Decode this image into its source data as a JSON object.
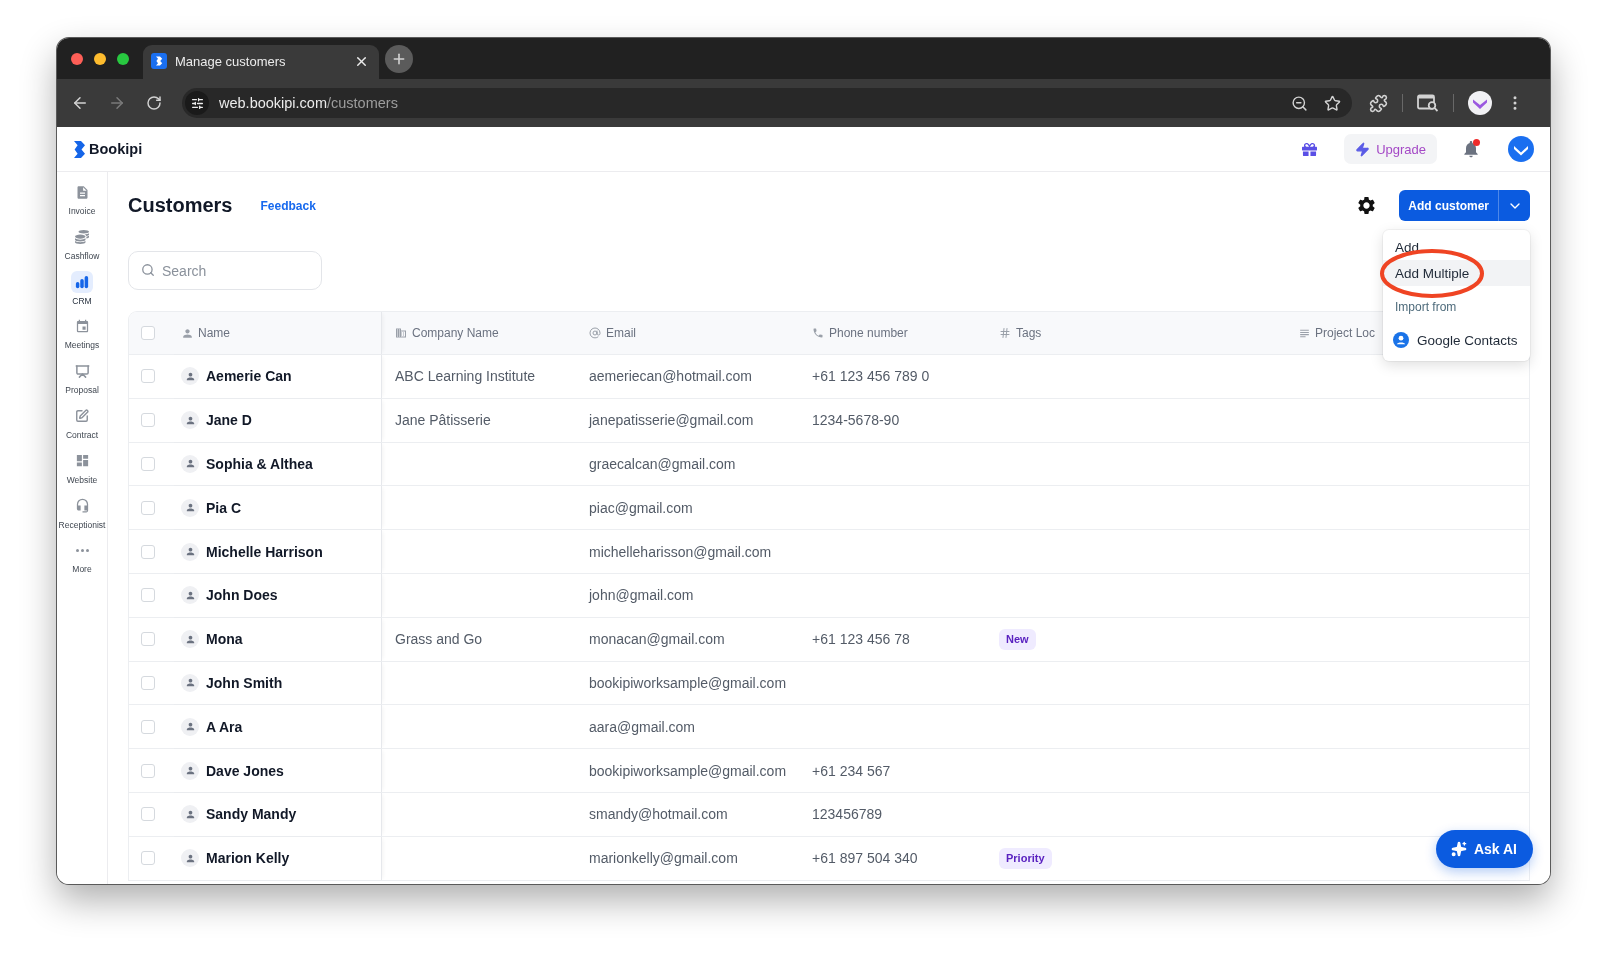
{
  "browser": {
    "tab": {
      "title": "Manage customers"
    },
    "navigation": {
      "forward_disabled": true
    },
    "address": {
      "host": "web.bookipi.com",
      "path": "/customers"
    }
  },
  "app_header": {
    "logo": "Bookipi",
    "upgrade_button": "Upgrade",
    "notifications": {
      "unread": true
    }
  },
  "sidebar": {
    "items": [
      {
        "label": "Invoice",
        "selected": false
      },
      {
        "label": "Cashflow",
        "selected": false
      },
      {
        "label": "CRM",
        "selected": true
      },
      {
        "label": "Meetings",
        "selected": false
      },
      {
        "label": "Proposal",
        "selected": false
      },
      {
        "label": "Contract",
        "selected": false
      },
      {
        "label": "Website",
        "selected": false
      },
      {
        "label": "Receptionist",
        "selected": false
      },
      {
        "label": "More",
        "selected": false
      }
    ]
  },
  "page": {
    "title": "Customers",
    "feedback_link": "Feedback",
    "add_button": "Add customer",
    "search": {
      "placeholder": "Search"
    }
  },
  "add_menu": {
    "items": [
      {
        "kind": "action",
        "label": "Add",
        "selected": false,
        "annotated": false
      },
      {
        "kind": "action",
        "label": "Add Multiple",
        "selected": true,
        "annotated": true
      },
      {
        "kind": "heading",
        "label": "Import from"
      },
      {
        "kind": "source",
        "label": "Google Contacts",
        "selected": false,
        "annotated": false
      }
    ]
  },
  "table": {
    "select_all": {
      "checked": false
    },
    "columns": [
      {
        "kind": "name",
        "label": "Name"
      },
      {
        "kind": "company",
        "label": "Company Name"
      },
      {
        "kind": "email",
        "label": "Email"
      },
      {
        "kind": "phone",
        "label": "Phone number"
      },
      {
        "kind": "tags",
        "label": "Tags"
      },
      {
        "kind": "other",
        "label": "Project Loc"
      }
    ],
    "rows": [
      {
        "checked": false,
        "name": "Aemerie Can",
        "company": "ABC Learning Institute",
        "email": "aemeriecan@hotmail.com",
        "phone": "+61 123 456 789 0"
      },
      {
        "checked": false,
        "name": "Jane D",
        "company": "Jane Pâtisserie",
        "email": "janepatisserie@gmail.com",
        "phone": "1234-5678-90"
      },
      {
        "checked": false,
        "name": "Sophia & Althea",
        "email": "graecalcan@gmail.com"
      },
      {
        "checked": false,
        "name": "Pia C",
        "email": "piac@gmail.com"
      },
      {
        "checked": false,
        "name": "Michelle Harrison",
        "email": "michelleharisson@gmail.com"
      },
      {
        "checked": false,
        "name": "John Does",
        "email": "john@gmail.com"
      },
      {
        "checked": false,
        "name": "Mona",
        "company": "Grass and Go",
        "email": "monacan@gmail.com",
        "phone": "+61 123 456 78",
        "tags": [
          "New"
        ]
      },
      {
        "checked": false,
        "name": "John Smith",
        "email": "bookipiworksample@gmail.com"
      },
      {
        "checked": false,
        "name": "A Ara",
        "email": "aara@gmail.com"
      },
      {
        "checked": false,
        "name": "Dave Jones",
        "email": "bookipiworksample@gmail.com",
        "phone": "+61 234 567"
      },
      {
        "checked": false,
        "name": "Sandy Mandy",
        "email": "smandy@hotmail.com",
        "phone": "123456789"
      },
      {
        "checked": false,
        "name": "Marion Kelly",
        "email": "marionkelly@gmail.com",
        "phone": "+61 897 504 340",
        "tags": [
          "Priority"
        ]
      }
    ]
  },
  "ask_ai_button": "Ask AI"
}
